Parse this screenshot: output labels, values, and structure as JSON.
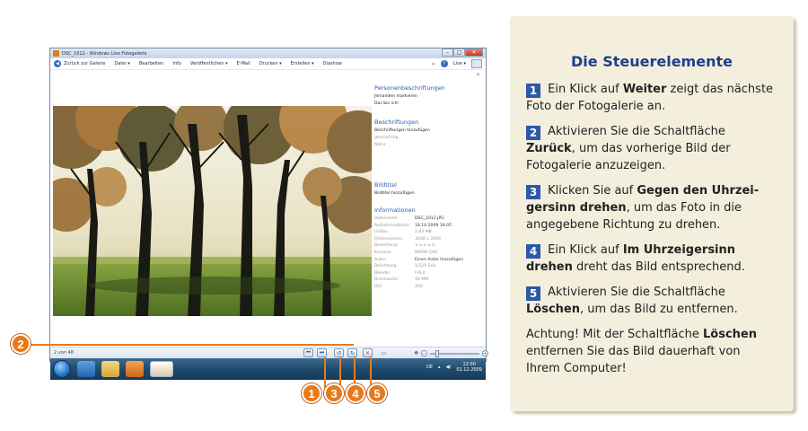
{
  "window": {
    "title": "DSC_1012 - Windows Live Fotogalerie",
    "controls": {
      "minimize": "–",
      "maximize": "□",
      "close": "✕"
    }
  },
  "menubar": {
    "back": "Zurück zur Galerie",
    "items": [
      "Datei ▾",
      "Bearbeiten",
      "Info",
      "Veröffentlichen ▾",
      "E-Mail",
      "Drucken ▾",
      "Erstellen ▾",
      "Diashow"
    ],
    "live": "Live ▾"
  },
  "sidebar": {
    "people": {
      "heading": "Personenbeschriftungen",
      "items": [
        "Jemanden markieren",
        "Das bin ich!"
      ]
    },
    "tags": {
      "heading": "Beschriftungen",
      "add": "Beschriftungen hinzufügen",
      "values": [
        "geocaching",
        "Natur"
      ]
    },
    "caption": {
      "heading": "Bildtitel",
      "add": "Bildtitel hinzufügen"
    },
    "info": {
      "heading": "Informationen",
      "rows": [
        {
          "k": "Dateiname:",
          "v": "DSC_1012.JPG"
        },
        {
          "k": "Aufnahmedatum:",
          "v": "18.10.2009 16:05"
        },
        {
          "k": "Größe:",
          "v": "2,83 MB"
        },
        {
          "k": "Dimensionen:",
          "v": "3008 x 2000"
        },
        {
          "k": "Bewertung:",
          "v": "☆☆☆☆☆"
        },
        {
          "k": "Kamera:",
          "v": "NIKON D40"
        },
        {
          "k": "Autor:",
          "v": "Einen Autor hinzufügen"
        },
        {
          "k": "Belichtung:",
          "v": "1/320 Sek."
        },
        {
          "k": "Blende:",
          "v": "F/8.0"
        },
        {
          "k": "Brennweite:",
          "v": "18 MM"
        },
        {
          "k": "ISO:",
          "v": "200"
        }
      ]
    }
  },
  "controls": {
    "count": "2 von 48"
  },
  "taskbar": {
    "lang": "DE",
    "time": "12:00",
    "date": "01.12.2009"
  },
  "callouts": [
    "1",
    "2",
    "3",
    "4",
    "5"
  ],
  "panel": {
    "title": "Die Steuerelemente",
    "p1": {
      "num": "1",
      "a": " Ein Klick auf ",
      "b": "Weiter",
      "c": " zeigt das nächste Foto der Fotogalerie an."
    },
    "p2": {
      "num": "2",
      "a": " Aktivieren Sie die Schaltfläche ",
      "b": "Zurück",
      "c": ", um das vorherige Bild der Fotogalerie anzuzeigen."
    },
    "p3": {
      "num": "3",
      "a": " Klicken Sie auf ",
      "b": "Gegen den Uhrzei­gersinn drehen",
      "c": ", um das Foto in die angegebene Richtung zu drehen."
    },
    "p4": {
      "num": "4",
      "a": " Ein Klick auf ",
      "b": "Im Uhrzeigersinn drehen",
      "c": " dreht das Bild entsprechend."
    },
    "p5": {
      "num": "5",
      "a": " Aktivieren Sie die Schaltfläche ",
      "b": "Löschen",
      "c": ", um das Bild zu entfernen."
    },
    "p6": {
      "a": "Achtung! Mit der Schaltfläche ",
      "b": "Löschen",
      "c": " entfernen Sie das Bild dauerhaft von Ihrem Computer!"
    }
  }
}
